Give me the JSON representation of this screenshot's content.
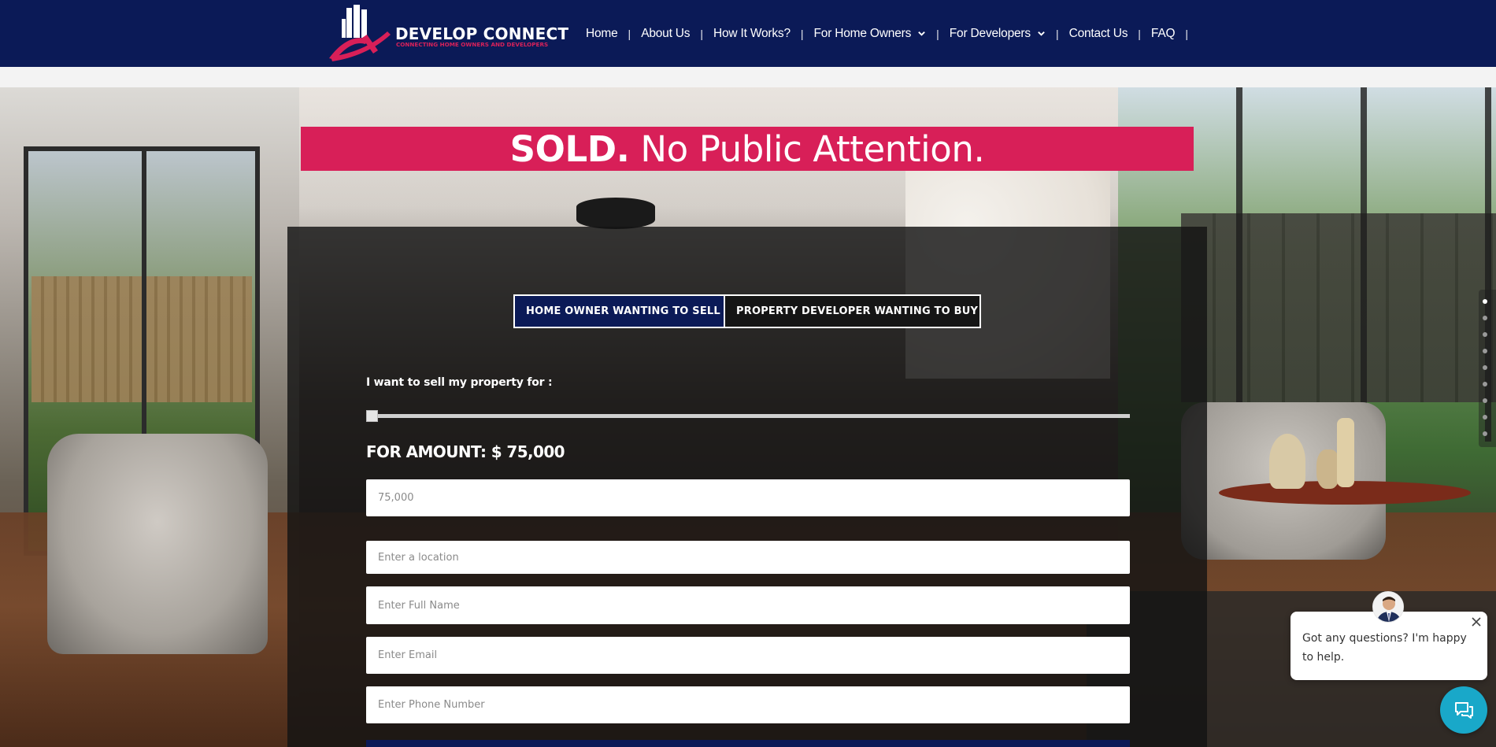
{
  "brand": {
    "title": "DEVELOP CONNECT",
    "tagline": "CONNECTING HOME OWNERS AND DEVELOPERS"
  },
  "nav": {
    "items": [
      {
        "label": "Home"
      },
      {
        "label": "About Us"
      },
      {
        "label": "How It Works?"
      },
      {
        "label": "For Home Owners"
      },
      {
        "label": "For Developers"
      },
      {
        "label": "Contact Us"
      },
      {
        "label": "FAQ"
      }
    ],
    "separator": "|"
  },
  "hero": {
    "headline_bold": "SOLD.",
    "headline_rest": "No Public Attention."
  },
  "form": {
    "tabs": [
      {
        "label": "HOME OWNER WANTING TO SELL"
      },
      {
        "label": "PROPERTY DEVELOPER WANTING TO BUY"
      }
    ],
    "sell_label": "I want to sell my property for :",
    "slider_value_fraction": 0.0,
    "amount_text": "FOR AMOUNT: $ 75,000",
    "fields": {
      "amount_placeholder": "75,000",
      "location_placeholder": "Enter a location",
      "name_placeholder": "Enter Full Name",
      "email_placeholder": "Enter Email",
      "phone_placeholder": "Enter Phone Number"
    }
  },
  "chat": {
    "message": "Got any questions? I'm happy to help."
  },
  "colors": {
    "header_bg": "#0b1a57",
    "accent": "#d81f58",
    "chat_launcher": "#19a8c9"
  }
}
